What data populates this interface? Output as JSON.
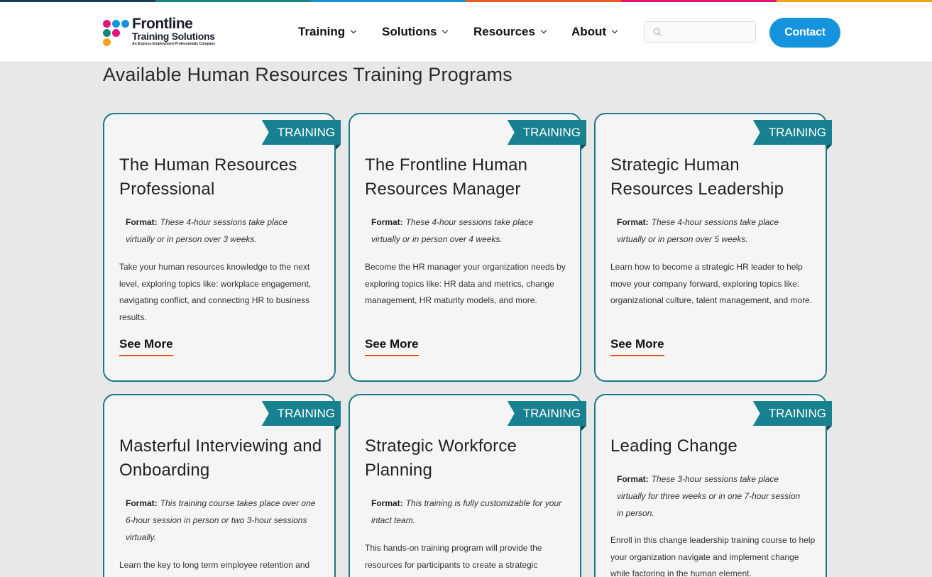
{
  "brand": {
    "stripe_colors": [
      "#1b3a5c",
      "#15877c",
      "#1594dd",
      "#ea5a1c",
      "#e4137a",
      "#f2a41d"
    ],
    "logo_line1": "Frontline",
    "logo_line2": "Training Solutions",
    "logo_line3": "An Express Employment Professionals Company",
    "logo_dot_colors": [
      "#e4137a",
      "#1594dd",
      "#1594dd",
      "#15877c",
      "#e4137a",
      "#f2a41d"
    ]
  },
  "nav": {
    "items": [
      {
        "label": "Training"
      },
      {
        "label": "Solutions"
      },
      {
        "label": "Resources"
      },
      {
        "label": "About"
      }
    ]
  },
  "search": {
    "placeholder": ""
  },
  "contact_label": "Contact",
  "page_title": "Available Human Resources Training Programs",
  "cards": [
    {
      "ribbon": "TRAINING",
      "title": "The Human Resources Professional",
      "format_label": "Format:",
      "format_text": "These 4-hour sessions take place virtually or in person over 3 weeks.",
      "description": "Take your human resources knowledge to the next level, exploring topics like: workplace engagement, navigating conflict, and connecting HR to business results.",
      "link": "See More"
    },
    {
      "ribbon": "TRAINING",
      "title": "The Frontline Human Resources Manager",
      "format_label": "Format:",
      "format_text": "These 4-hour sessions take place virtually or in person over 4 weeks.",
      "description": "Become the HR manager your organization needs by exploring topics like: HR data and metrics, change management, HR maturity models, and more.",
      "link": "See More"
    },
    {
      "ribbon": "TRAINING",
      "title": "Strategic Human Resources Leadership",
      "format_label": "Format:",
      "format_text": "These 4-hour sessions take place virtually or in person over 5 weeks.",
      "description": "Learn how to become a strategic HR leader to help move your company forward, exploring topics like: organizational culture, talent management, and more.",
      "link": "See More"
    },
    {
      "ribbon": "TRAINING",
      "title": "Masterful Interviewing and Onboarding",
      "format_label": "Format:",
      "format_text": "This training course takes place over one 6-hour session in person or two 3-hour sessions virtually.",
      "description": "Learn the key to long term employee retention and"
    },
    {
      "ribbon": "TRAINING",
      "title": "Strategic Workforce Planning",
      "format_label": "Format:",
      "format_text": "This training is fully customizable for your intact team.",
      "description": "This hands-on training program will provide the resources for participants to create a strategic"
    },
    {
      "ribbon": "TRAINING",
      "title": "Leading Change",
      "format_label": "Format:",
      "format_text": "These 3-hour sessions take place virtually for three weeks or in one 7-hour session in person.",
      "description": "Enroll in this change leadership training course to help your organization navigate and implement change while factoring in the human element."
    }
  ]
}
